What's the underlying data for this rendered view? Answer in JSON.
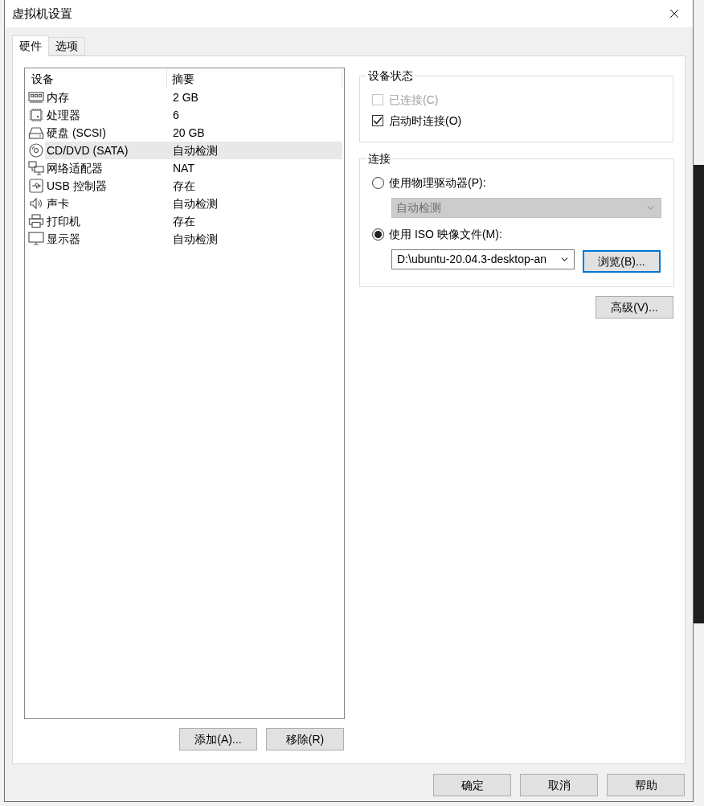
{
  "window": {
    "title": "虚拟机设置"
  },
  "tabs": [
    {
      "label": "硬件",
      "selected": true
    },
    {
      "label": "选项",
      "selected": false
    }
  ],
  "device_list": {
    "columns": [
      "设备",
      "摘要"
    ],
    "rows": [
      {
        "kind": "memory",
        "device": "内存",
        "summary": "2 GB",
        "selected": false
      },
      {
        "kind": "processor",
        "device": "处理器",
        "summary": "6",
        "selected": false
      },
      {
        "kind": "hard_disk",
        "device": "硬盘 (SCSI)",
        "summary": "20 GB",
        "selected": false
      },
      {
        "kind": "cd_dvd",
        "device": "CD/DVD (SATA)",
        "summary": "自动检测",
        "selected": true
      },
      {
        "kind": "network",
        "device": "网络适配器",
        "summary": "NAT",
        "selected": false
      },
      {
        "kind": "usb",
        "device": "USB 控制器",
        "summary": "存在",
        "selected": false
      },
      {
        "kind": "sound",
        "device": "声卡",
        "summary": "自动检测",
        "selected": false
      },
      {
        "kind": "printer",
        "device": "打印机",
        "summary": "存在",
        "selected": false
      },
      {
        "kind": "display",
        "device": "显示器",
        "summary": "自动检测",
        "selected": false
      }
    ]
  },
  "list_buttons": [
    "添加(A)...",
    "移除(R)"
  ],
  "device_status": {
    "title": "设备状态",
    "options": [
      {
        "label": "已连接(C)",
        "checked": false,
        "disabled": true
      },
      {
        "label": "启动时连接(O)",
        "checked": true,
        "disabled": false
      }
    ]
  },
  "connection": {
    "title": "连接",
    "options": [
      {
        "label": "使用物理驱动器(P):",
        "selected": false,
        "dropdown": {
          "value": "自动检测",
          "disabled": true
        }
      },
      {
        "label": "使用 ISO 映像文件(M):",
        "selected": true,
        "path_field": {
          "value": "D:\\ubuntu-20.04.3-desktop-an"
        },
        "browse_button": {
          "label": "浏览(B)...",
          "focused": true
        }
      }
    ]
  },
  "advanced_button": {
    "label": "高级(V)..."
  },
  "dialog_buttons": [
    "确定",
    "取消",
    "帮助"
  ]
}
